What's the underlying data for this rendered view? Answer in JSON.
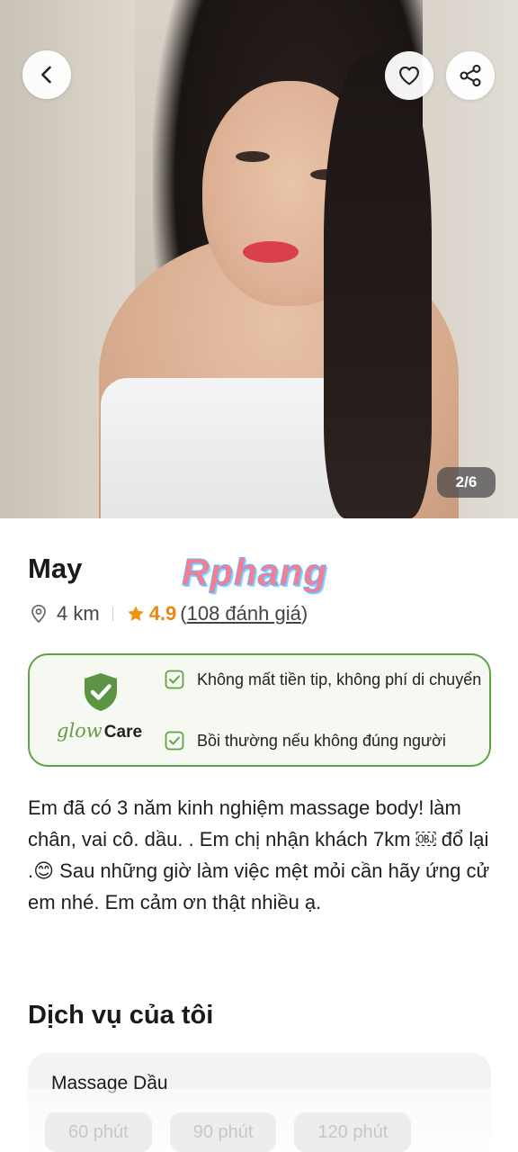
{
  "hero": {
    "page_counter": "2/6",
    "back_icon": "chevron-left-icon",
    "favorite_icon": "heart-icon",
    "share_icon": "share-icon"
  },
  "profile": {
    "name": "May",
    "watermark": "Rphang",
    "distance": "4 km",
    "rating": "4.9",
    "reviews_open": "(",
    "reviews": "108 đánh giá",
    "reviews_close": ")"
  },
  "care": {
    "brand_glow": "glow",
    "brand_care": "Care",
    "items": [
      "Không mất tiền tip, không phí di chuyển",
      "Bồi thường nếu không đúng người"
    ],
    "accent": "#5fa347"
  },
  "description": "Em đã có 3 năm kinh nghiệm massage body! làm chân, vai cô. dầu. . Em chị nhận khách 7km ￼ đổ lại .😊 Sau những giờ làm việc mệt mỏi cần hãy ứng cử em nhé. Em cảm ơn thật nhiều ạ.",
  "services": {
    "title": "Dịch vụ của tôi",
    "items": [
      {
        "name": "Massage Dầu",
        "durations": [
          "60 phút",
          "90 phút",
          "120 phút"
        ]
      }
    ]
  }
}
